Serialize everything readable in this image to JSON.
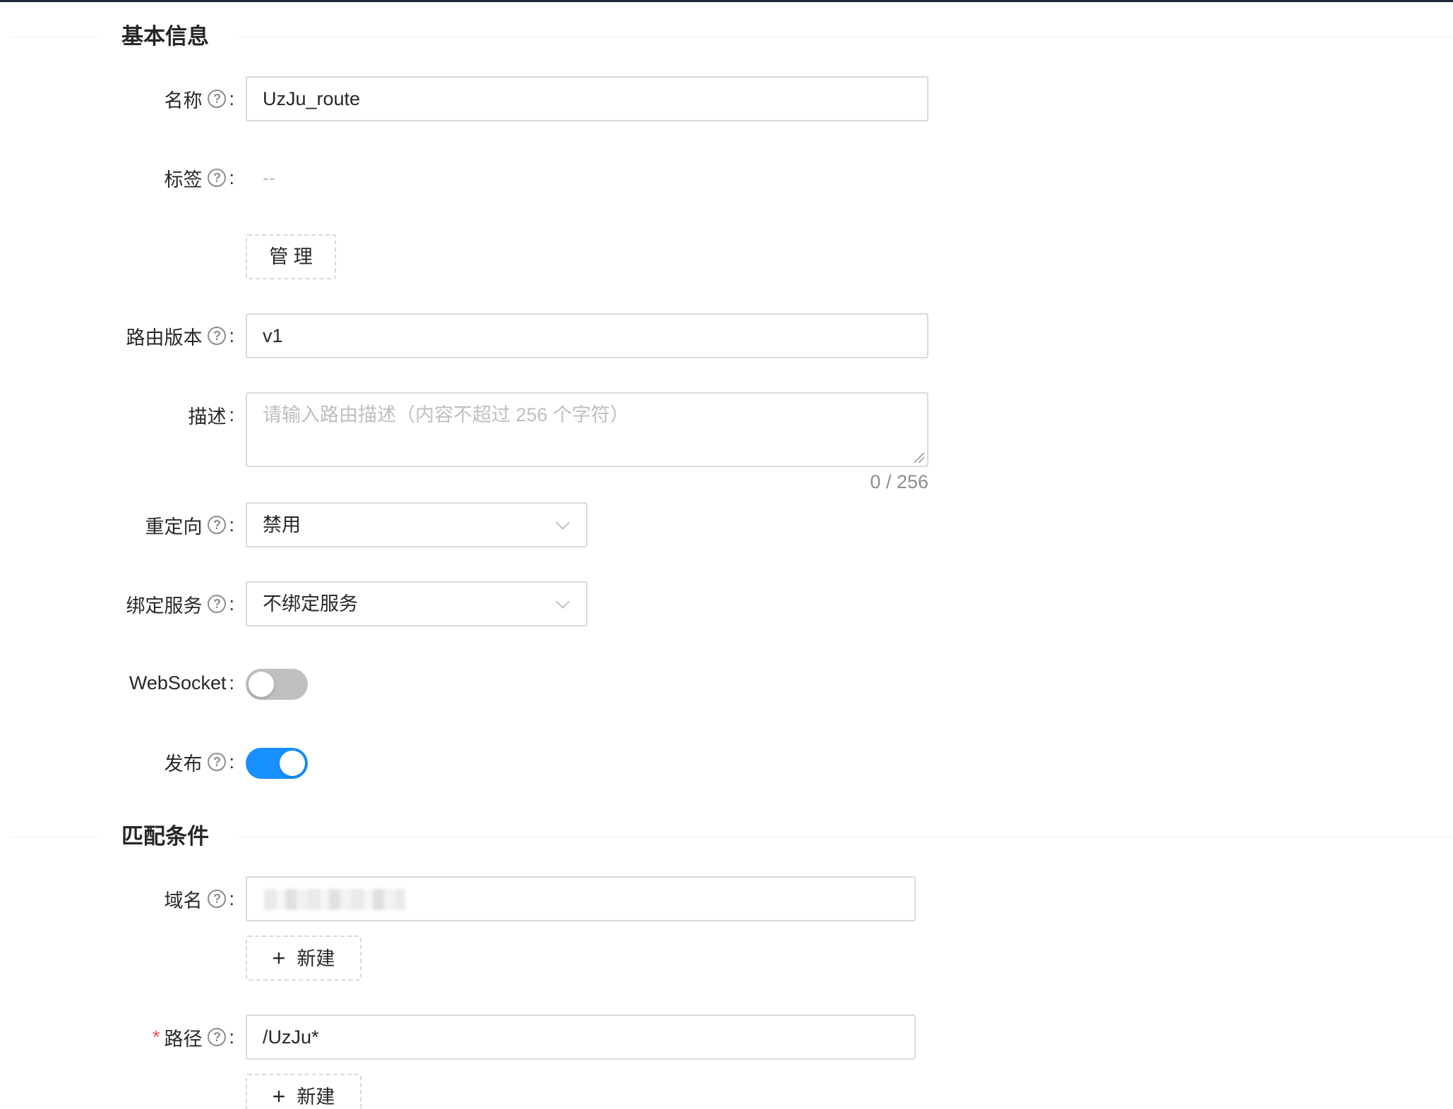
{
  "sections": {
    "basic": "基本信息",
    "match": "匹配条件"
  },
  "colors": {
    "primary": "#1890ff",
    "required": "#ff4d4f",
    "border": "#d9d9d9"
  },
  "form": {
    "name": {
      "label": "名称",
      "value": "UzJu_route"
    },
    "tags": {
      "label": "标签",
      "value": "--",
      "manage_button": "管 理"
    },
    "version": {
      "label": "路由版本",
      "value": "v1"
    },
    "description": {
      "label": "描述",
      "placeholder": "请输入路由描述（内容不超过 256 个字符）",
      "counter": "0 / 256"
    },
    "redirect": {
      "label": "重定向",
      "value": "禁用"
    },
    "service": {
      "label": "绑定服务",
      "value": "不绑定服务"
    },
    "websocket": {
      "label": "WebSocket",
      "enabled": false
    },
    "publish": {
      "label": "发布",
      "enabled": true
    },
    "host": {
      "label": "域名",
      "value": "",
      "add_button": "新建"
    },
    "path": {
      "label": "路径",
      "required_mark": "*",
      "value": "/UzJu*",
      "add_button": "新建"
    }
  },
  "icons": {
    "help": "question-circle-icon",
    "arrow": "chevron-down-icon",
    "plus": "plus-icon"
  }
}
